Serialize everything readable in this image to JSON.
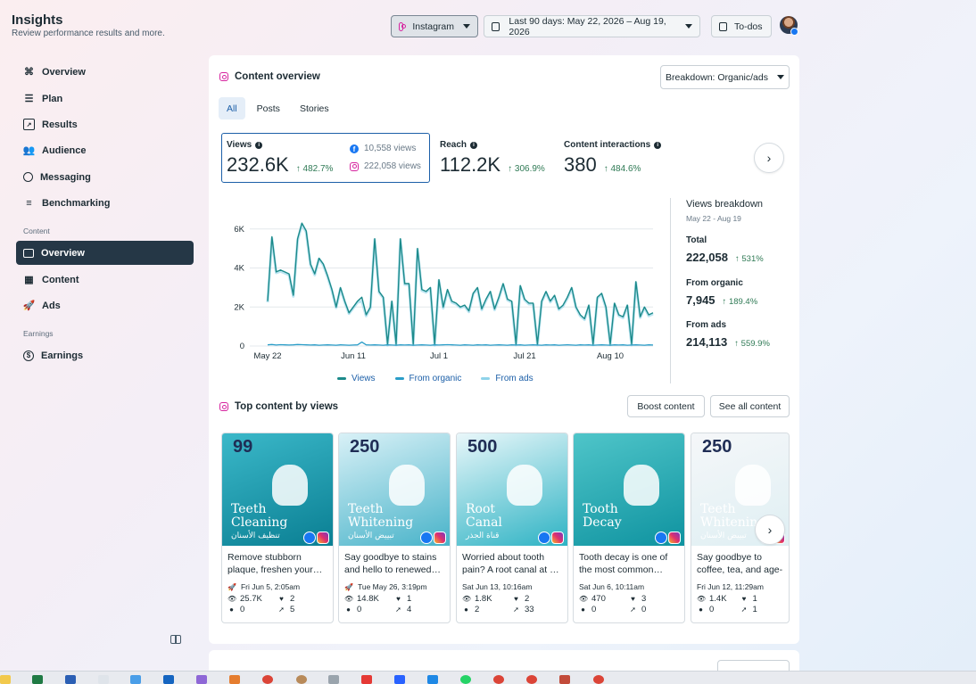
{
  "header": {
    "title": "Insights",
    "subtitle": "Review performance results and more.",
    "platform_label": "Instagram",
    "date_range_label": "Last 90 days: May 22, 2026 – Aug 19, 2026",
    "todos_label": "To-dos"
  },
  "sidebar": {
    "items": [
      {
        "label": "Overview",
        "icon": "overview-icon"
      },
      {
        "label": "Plan",
        "icon": "plan-icon"
      },
      {
        "label": "Results",
        "icon": "results-icon"
      },
      {
        "label": "Audience",
        "icon": "audience-icon"
      },
      {
        "label": "Messaging",
        "icon": "messaging-icon"
      },
      {
        "label": "Benchmarking",
        "icon": "benchmarking-icon"
      }
    ],
    "content_section": "Content",
    "content_items": [
      {
        "label": "Overview",
        "icon": "content-overview-icon"
      },
      {
        "label": "Content",
        "icon": "content-icon"
      },
      {
        "label": "Ads",
        "icon": "ads-icon"
      }
    ],
    "earnings_section": "Earnings",
    "earnings_items": [
      {
        "label": "Earnings",
        "icon": "earnings-icon"
      }
    ]
  },
  "overview": {
    "title": "Content overview",
    "breakdown_label": "Breakdown: Organic/ads",
    "tabs": [
      "All",
      "Posts",
      "Stories"
    ],
    "metrics": [
      {
        "label": "Views",
        "value": "232.6K",
        "change": "482.7%"
      },
      {
        "label": "Reach",
        "value": "112.2K",
        "change": "306.9%"
      },
      {
        "label": "Content interactions",
        "value": "380",
        "change": "484.6%"
      }
    ],
    "views_facebook": "10,558 views",
    "views_instagram": "222,058 views"
  },
  "breakdown": {
    "title": "Views breakdown",
    "range": "May 22 - Aug 19",
    "total_label": "Total",
    "total_value": "222,058",
    "total_change": "531%",
    "organic_label": "From organic",
    "organic_value": "7,945",
    "organic_change": "189.4%",
    "ads_label": "From ads",
    "ads_value": "214,113",
    "ads_change": "559.9%"
  },
  "chart_data": {
    "type": "line",
    "x_tick_labels": [
      "May 22",
      "Jun 11",
      "Jul 1",
      "Jul 21",
      "Aug 10"
    ],
    "y_tick_labels": [
      "0",
      "2K",
      "4K",
      "6K"
    ],
    "ylim": [
      0,
      6400
    ],
    "legend": [
      "Views",
      "From organic",
      "From ads"
    ],
    "legend_position": "bottom",
    "grid": true,
    "series": [
      {
        "name": "Views",
        "color": "#1c8a8a",
        "values": [
          2300,
          5600,
          3800,
          3900,
          3800,
          3700,
          2600,
          5500,
          6300,
          5900,
          4200,
          3700,
          4500,
          4200,
          3600,
          2900,
          2000,
          3000,
          2300,
          1700,
          2000,
          2300,
          2500,
          1600,
          2000,
          5500,
          2800,
          2500,
          100,
          2300,
          100,
          5500,
          3200,
          3200,
          100,
          5000,
          2900,
          2800,
          3000,
          100,
          3400,
          2000,
          2900,
          2300,
          2200,
          2000,
          2100,
          1800,
          2700,
          3000,
          1900,
          2400,
          2800,
          1900,
          2500,
          3200,
          2400,
          2300,
          100,
          3100,
          2400,
          2200,
          2200,
          100,
          2300,
          2800,
          2300,
          2600,
          1900,
          2100,
          2500,
          3000,
          2000,
          1600,
          1400,
          2100,
          100,
          2500,
          2700,
          2000,
          100,
          2200,
          1600,
          1500,
          2100,
          100,
          3300,
          1500,
          2000,
          1600,
          1700
        ]
      },
      {
        "name": "From organic",
        "color": "#2a9dc8",
        "values": [
          60,
          80,
          50,
          70,
          60,
          50,
          60,
          80,
          70,
          60,
          50,
          60,
          40,
          50,
          60,
          50,
          40,
          60,
          50,
          40,
          50,
          60,
          200,
          60,
          50,
          60,
          50,
          40,
          60,
          50,
          40,
          60,
          50,
          60,
          40,
          50,
          60,
          50,
          40,
          60,
          50,
          60,
          70,
          60,
          50,
          40,
          60,
          50,
          40,
          60,
          50,
          60,
          40,
          50,
          60,
          50,
          40,
          60,
          50,
          60,
          40,
          50,
          60,
          50,
          40,
          60,
          50,
          60,
          40,
          50,
          60,
          50,
          40,
          60,
          50,
          60,
          40,
          50,
          60,
          50,
          40,
          60,
          50,
          60,
          40,
          50,
          60,
          50,
          40,
          60,
          50
        ]
      },
      {
        "name": "From ads",
        "color": "#8fd3ea",
        "values": [
          2240,
          5520,
          3750,
          3830,
          3740,
          3650,
          2540,
          5420,
          6230,
          5840,
          4150,
          3640,
          4460,
          4150,
          3540,
          2850,
          1960,
          2940,
          2250,
          1660,
          1950,
          2240,
          2300,
          1540,
          1950,
          5440,
          2750,
          2460,
          40,
          2250,
          60,
          5440,
          3150,
          3140,
          60,
          4950,
          2840,
          2750,
          2960,
          40,
          3350,
          1940,
          2830,
          2240,
          2150,
          1960,
          2040,
          1750,
          2660,
          2940,
          1850,
          2340,
          2760,
          1850,
          2440,
          3150,
          2360,
          2240,
          50,
          3040,
          2360,
          2150,
          2140,
          50,
          2260,
          2740,
          2250,
          2540,
          1860,
          2050,
          2440,
          2950,
          1960,
          1540,
          1350,
          2040,
          60,
          2450,
          2640,
          1950,
          60,
          2140,
          1550,
          1440,
          2060,
          50,
          3240,
          1450,
          1960,
          1540,
          1650
        ]
      }
    ]
  },
  "top_content": {
    "title": "Top content by views",
    "boost_label": "Boost content",
    "see_all_label": "See all content",
    "posts": [
      {
        "caption": "Remove stubborn plaque, freshen your…",
        "date": "Fri Jun 5, 2:05am",
        "views": "25.7K",
        "likes": "2",
        "comments": "0",
        "shares": "5",
        "boosted": true,
        "thumb_title": "Teeth Cleaning",
        "thumb_ar": "تنظيف الأسنان",
        "thumb_num": "99",
        "bg1": "#3bb8c9",
        "bg2": "#0a7f93"
      },
      {
        "caption": "Say goodbye to stains and hello to renewed…",
        "date": "Tue May 26, 3:19pm",
        "views": "14.8K",
        "likes": "1",
        "comments": "0",
        "shares": "4",
        "boosted": true,
        "thumb_title": "Teeth Whitening",
        "thumb_ar": "تبييض الأسنان",
        "thumb_num": "250",
        "bg1": "#d9f1f7",
        "bg2": "#48b3c9"
      },
      {
        "caption": "Worried about tooth pain? A root canal at …",
        "date": "Sat Jun 13, 10:16am",
        "views": "1.8K",
        "likes": "2",
        "comments": "2",
        "shares": "33",
        "boosted": false,
        "thumb_title": "Root Canal",
        "thumb_ar": "قناة الجذر",
        "thumb_num": "500",
        "bg1": "#e9f7fa",
        "bg2": "#2eb3c4"
      },
      {
        "caption": "Tooth decay is one of the most common…",
        "date": "Sat Jun 6, 10:11am",
        "views": "470",
        "likes": "3",
        "comments": "0",
        "shares": "0",
        "boosted": false,
        "thumb_title": "Tooth Decay",
        "thumb_ar": "",
        "thumb_num": "",
        "bg1": "#4fc5c9",
        "bg2": "#0f93a0"
      },
      {
        "caption": "Say goodbye to coffee, tea, and age-related…",
        "date": "Fri Jun 12, 11:29am",
        "views": "1.4K",
        "likes": "1",
        "comments": "0",
        "shares": "1",
        "boosted": false,
        "thumb_title": "Teeth Whitening",
        "thumb_ar": "تبييض الأسنان",
        "thumb_num": "250",
        "bg1": "#f5f7f9",
        "bg2": "#dfeff3"
      }
    ]
  },
  "colors": {
    "accent": "#1c5fa8",
    "sidebar_active": "#253746",
    "positive": "#2f7a55"
  }
}
